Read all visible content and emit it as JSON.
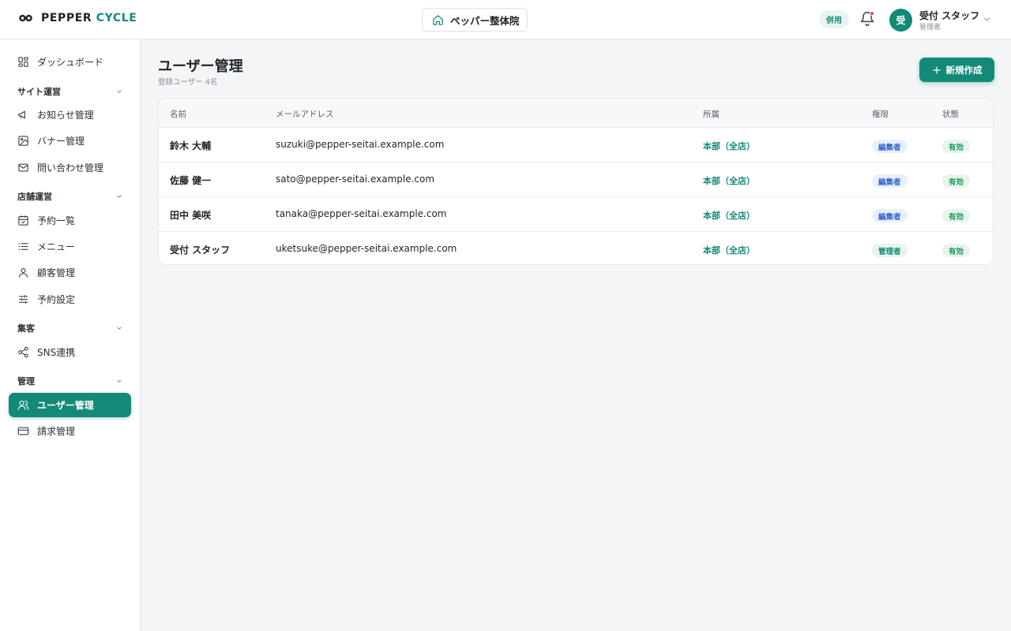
{
  "header": {
    "logo_main": "PEPPER",
    "logo_accent": "CYCLE",
    "shop_name": "ペッパー整体院",
    "mode_badge": "併用",
    "user_avatar": "受",
    "user_name": "受付 スタッフ",
    "user_role": "管理者"
  },
  "sidebar": {
    "dashboard": "ダッシュボード",
    "groups": [
      {
        "label": "サイト運営",
        "items": [
          "お知らせ管理",
          "バナー管理",
          "問い合わせ管理"
        ]
      },
      {
        "label": "店舗運営",
        "items": [
          "予約一覧",
          "メニュー",
          "顧客管理",
          "予約設定"
        ]
      },
      {
        "label": "集客",
        "items": [
          "SNS連携"
        ]
      },
      {
        "label": "管理",
        "items": [
          "ユーザー管理",
          "請求管理"
        ]
      }
    ],
    "active": "ユーザー管理"
  },
  "main": {
    "title": "ユーザー管理",
    "subtitle": "登録ユーザー 4名",
    "new_button": "新規作成",
    "columns": [
      "名前",
      "メールアドレス",
      "所属",
      "権限",
      "状態"
    ],
    "rows": [
      {
        "name": "鈴木 大輔",
        "email": "suzuki@pepper-seitai.example.com",
        "store": "本部（全店）",
        "role": "編集者",
        "status": "有効"
      },
      {
        "name": "佐藤 健一",
        "email": "sato@pepper-seitai.example.com",
        "store": "本部（全店）",
        "role": "編集者",
        "status": "有効"
      },
      {
        "name": "田中 美咲",
        "email": "tanaka@pepper-seitai.example.com",
        "store": "本部（全店）",
        "role": "編集者",
        "status": "有効"
      },
      {
        "name": "受付 スタッフ",
        "email": "uketsuke@pepper-seitai.example.com",
        "store": "本部（全店）",
        "role": "管理者",
        "status": "有効"
      }
    ]
  },
  "colors": {
    "accent": "#138a78",
    "notification_dot": "#e5484d",
    "editor_badge": "#3565c9",
    "status_active": "#1f9a54"
  }
}
